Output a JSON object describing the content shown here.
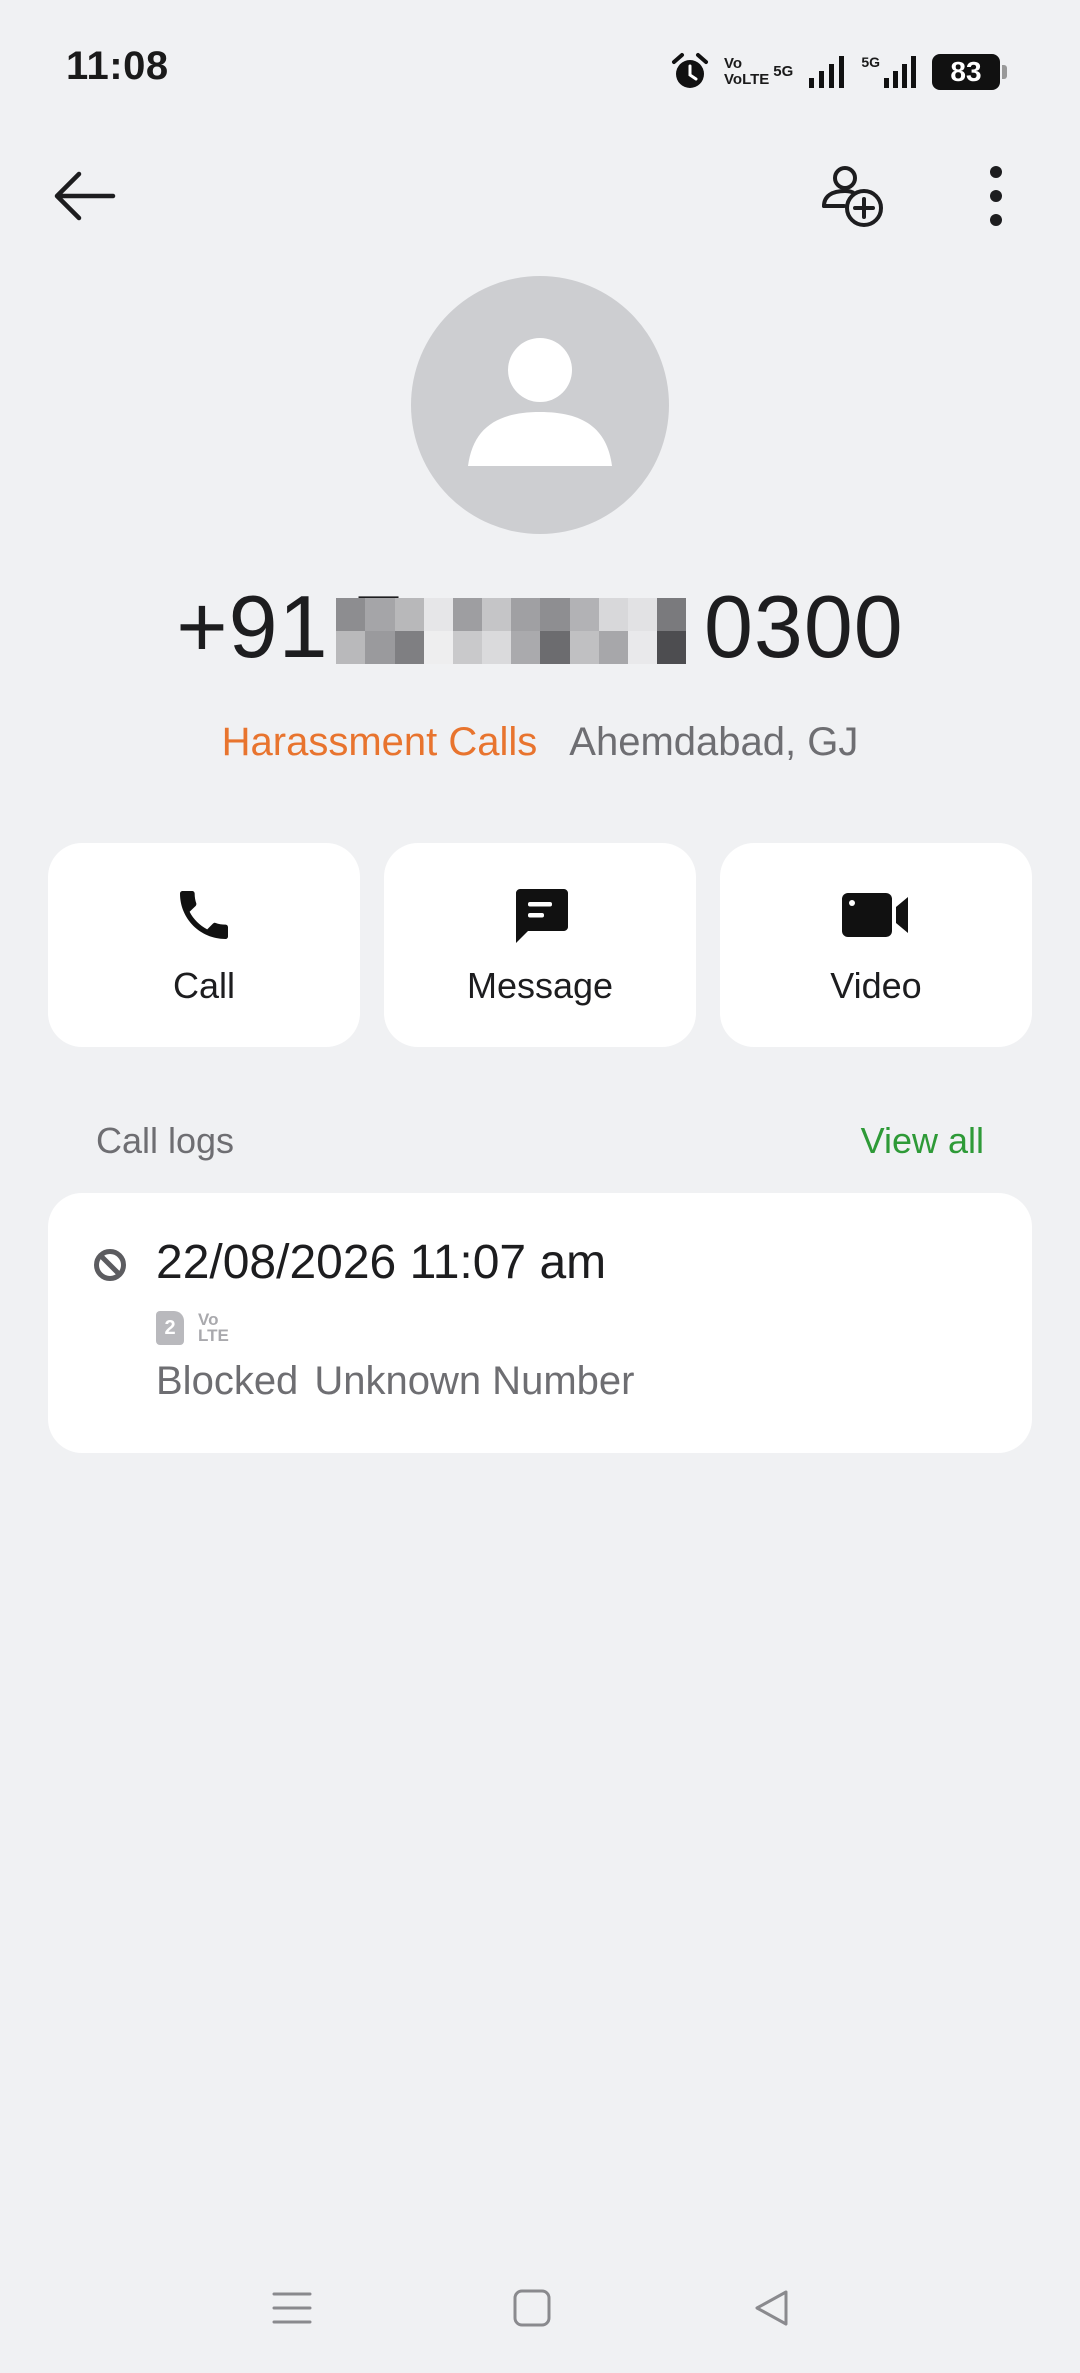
{
  "status_bar": {
    "time": "11:08",
    "battery": "83",
    "network_primary": [
      "Vo",
      "VoLTE"
    ],
    "network_primary_tag": "5G",
    "network_secondary": "5G",
    "icons": [
      "alarm-icon",
      "volte-icon",
      "signal-icon",
      "signal-5g-icon",
      "battery-icon"
    ]
  },
  "top_bar": {
    "back_icon": "arrow-left-icon",
    "add_contact_icon": "add-contact-icon",
    "more_icon": "more-vertical-icon"
  },
  "contact": {
    "avatar_icon": "person-icon",
    "number_prefix": "+91 7",
    "number_suffix": "0300",
    "tag": "Harassment Calls",
    "location": "Ahemdabad, GJ"
  },
  "actions": [
    {
      "label": "Call",
      "icon": "phone-icon"
    },
    {
      "label": "Message",
      "icon": "message-icon"
    },
    {
      "label": "Video",
      "icon": "video-icon"
    }
  ],
  "call_logs": {
    "title": "Call logs",
    "view_all": "View all",
    "entries": [
      {
        "datetime": "22/08/2026 11:07 am",
        "sim": "2",
        "network": [
          "Vo",
          "LTE"
        ],
        "status": "Blocked",
        "type": "Unknown Number",
        "icon": "blocked-icon"
      }
    ]
  },
  "nav_bar": {
    "icons": [
      "menu-icon",
      "home-icon",
      "back-triangle-icon"
    ]
  },
  "colors": {
    "background": "#f0f1f3",
    "card": "#ffffff",
    "harassment": "#e8742e",
    "view_all": "#2e9a37",
    "secondary_text": "#6e6e72"
  }
}
